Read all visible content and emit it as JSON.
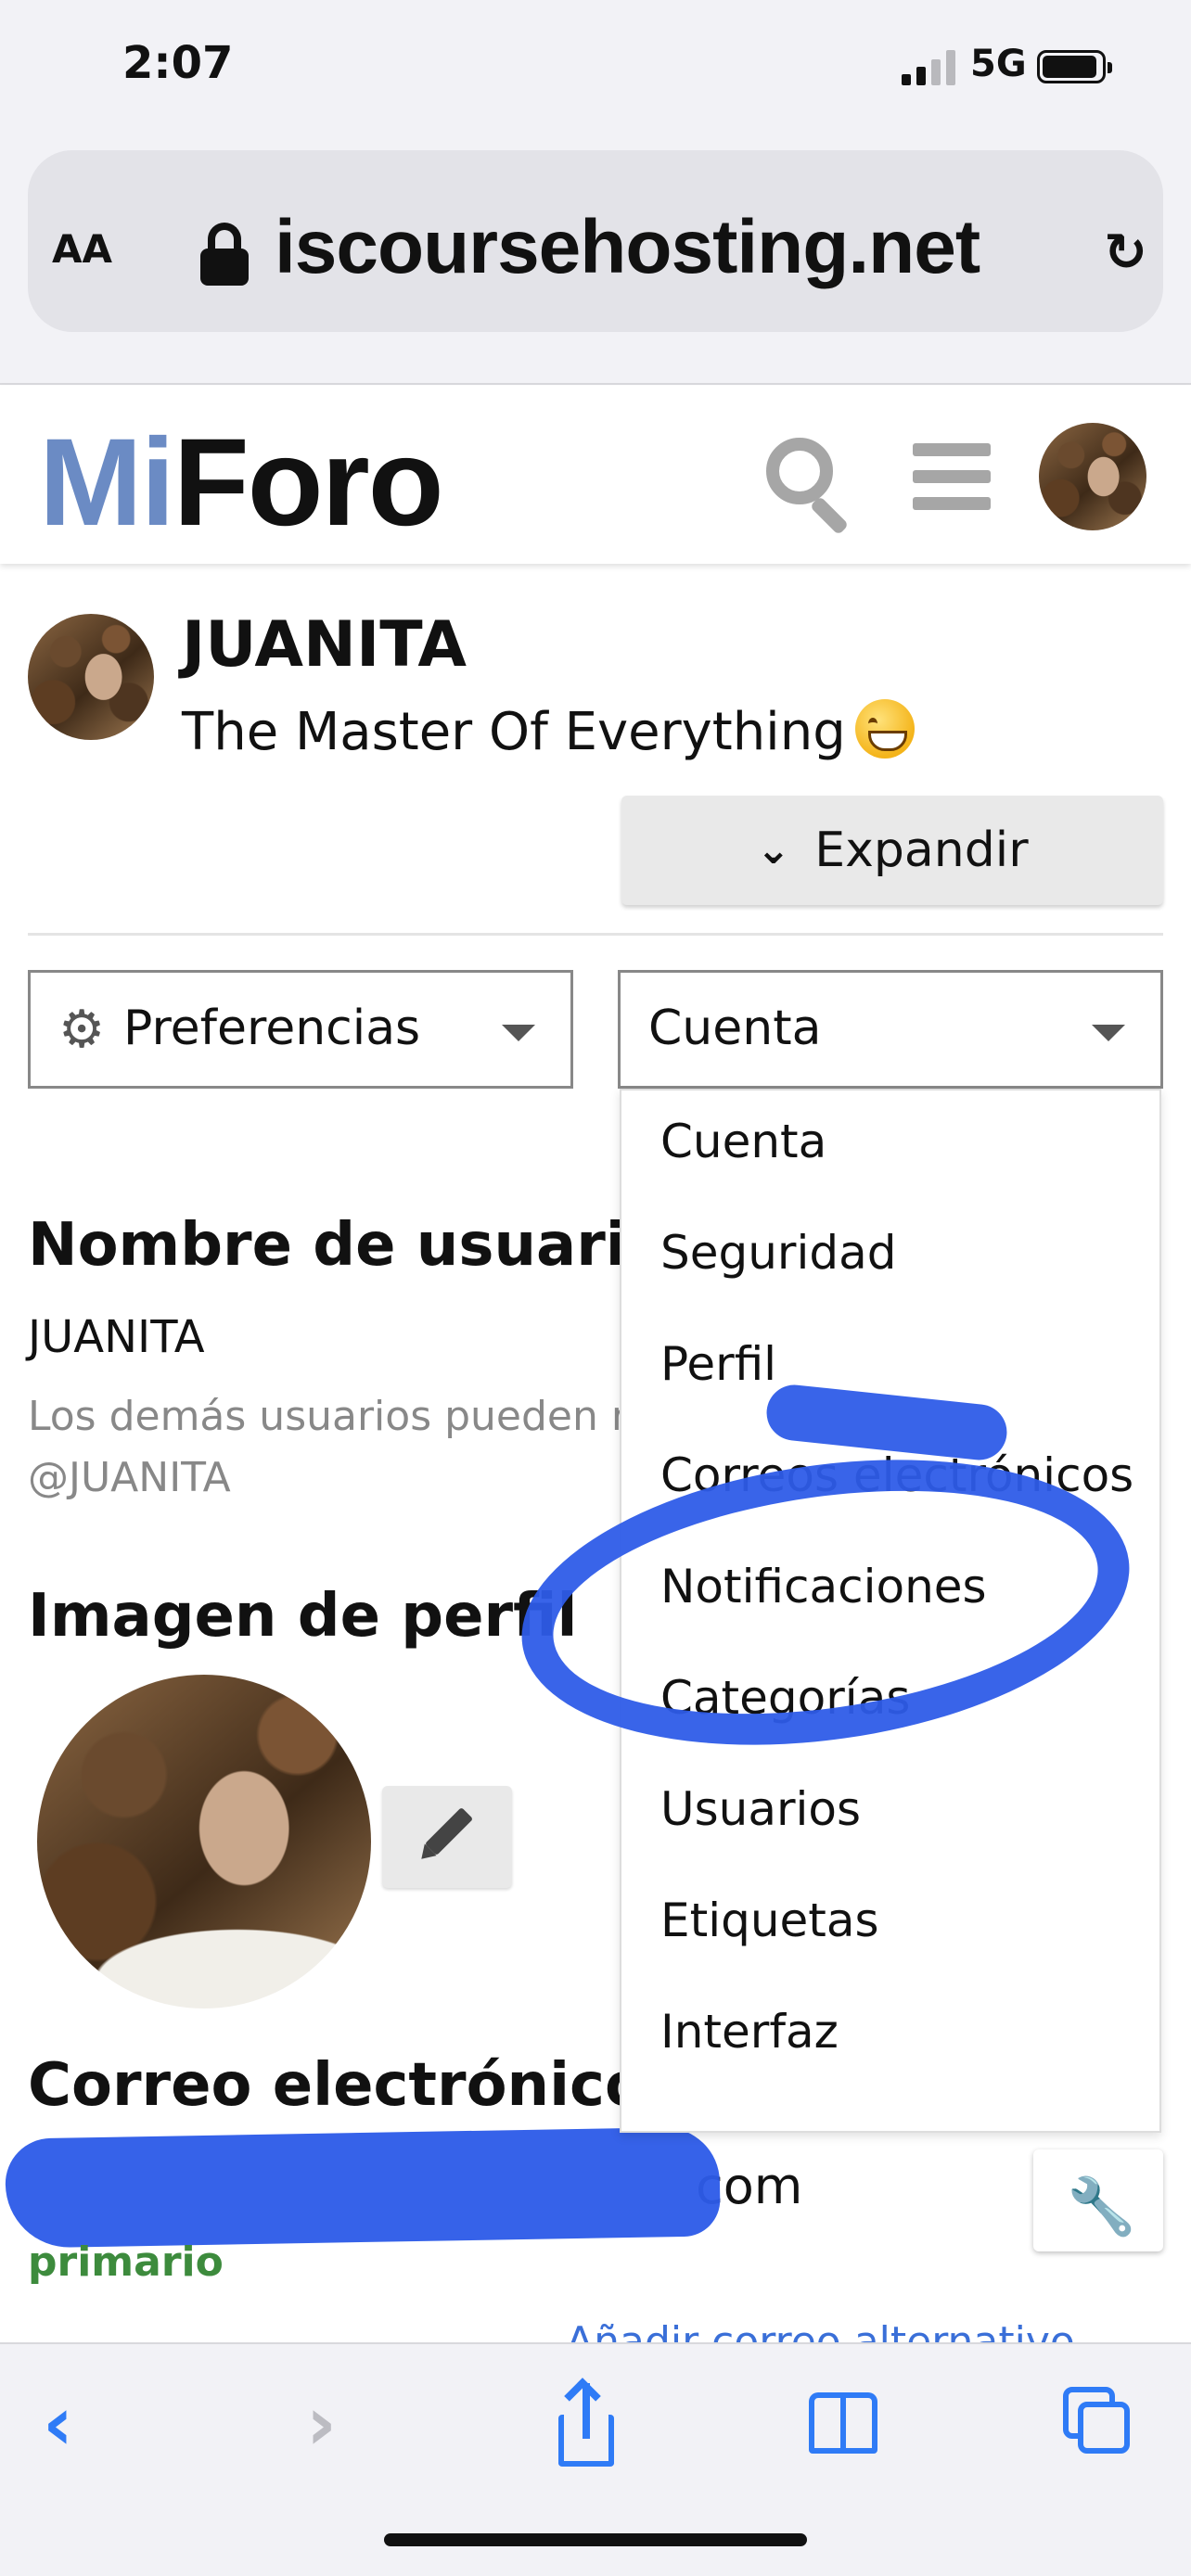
{
  "status_bar": {
    "time": "2:07",
    "network": "5G"
  },
  "browser": {
    "text_size_label": "AA",
    "url": "iscoursehosting.net"
  },
  "site": {
    "logo_part1": "Mi",
    "logo_part2": "Foro"
  },
  "profile": {
    "username": "JUANITA",
    "title": "The Master Of Everything",
    "expand_label": "Expandir"
  },
  "selects": {
    "preferences": "Preferencias",
    "account": "Cuenta"
  },
  "dropdown": {
    "items": [
      "Cuenta",
      "Seguridad",
      "Perfil",
      "Correos electrónicos",
      "Notificaciones",
      "Categorías",
      "Usuarios",
      "Etiquetas",
      "Interfaz"
    ]
  },
  "content": {
    "username_heading": "Nombre de usuario",
    "username_value": "JUANITA",
    "username_help": "Los demás usuarios pueden m",
    "mention": "@JUANITA",
    "avatar_heading": "Imagen de perfil",
    "email_heading": "Correo electrónico",
    "email_suffix": "com",
    "email_status": "primario",
    "add_alternate": "Añadir correo alternativo"
  },
  "icons": [
    "lock-icon",
    "reload-icon",
    "search-icon",
    "hamburger-icon",
    "gear-icon",
    "chevrons-down-icon",
    "pencil-icon",
    "wrench-icon",
    "back-icon",
    "forward-icon",
    "share-icon",
    "bookmarks-icon",
    "tabs-icon"
  ],
  "colors": {
    "annotation_blue": "#2e5ce8",
    "logo_blue": "#6b8bc4",
    "primary_green": "#3d8b3d",
    "ios_blue": "#2f7bf6"
  }
}
